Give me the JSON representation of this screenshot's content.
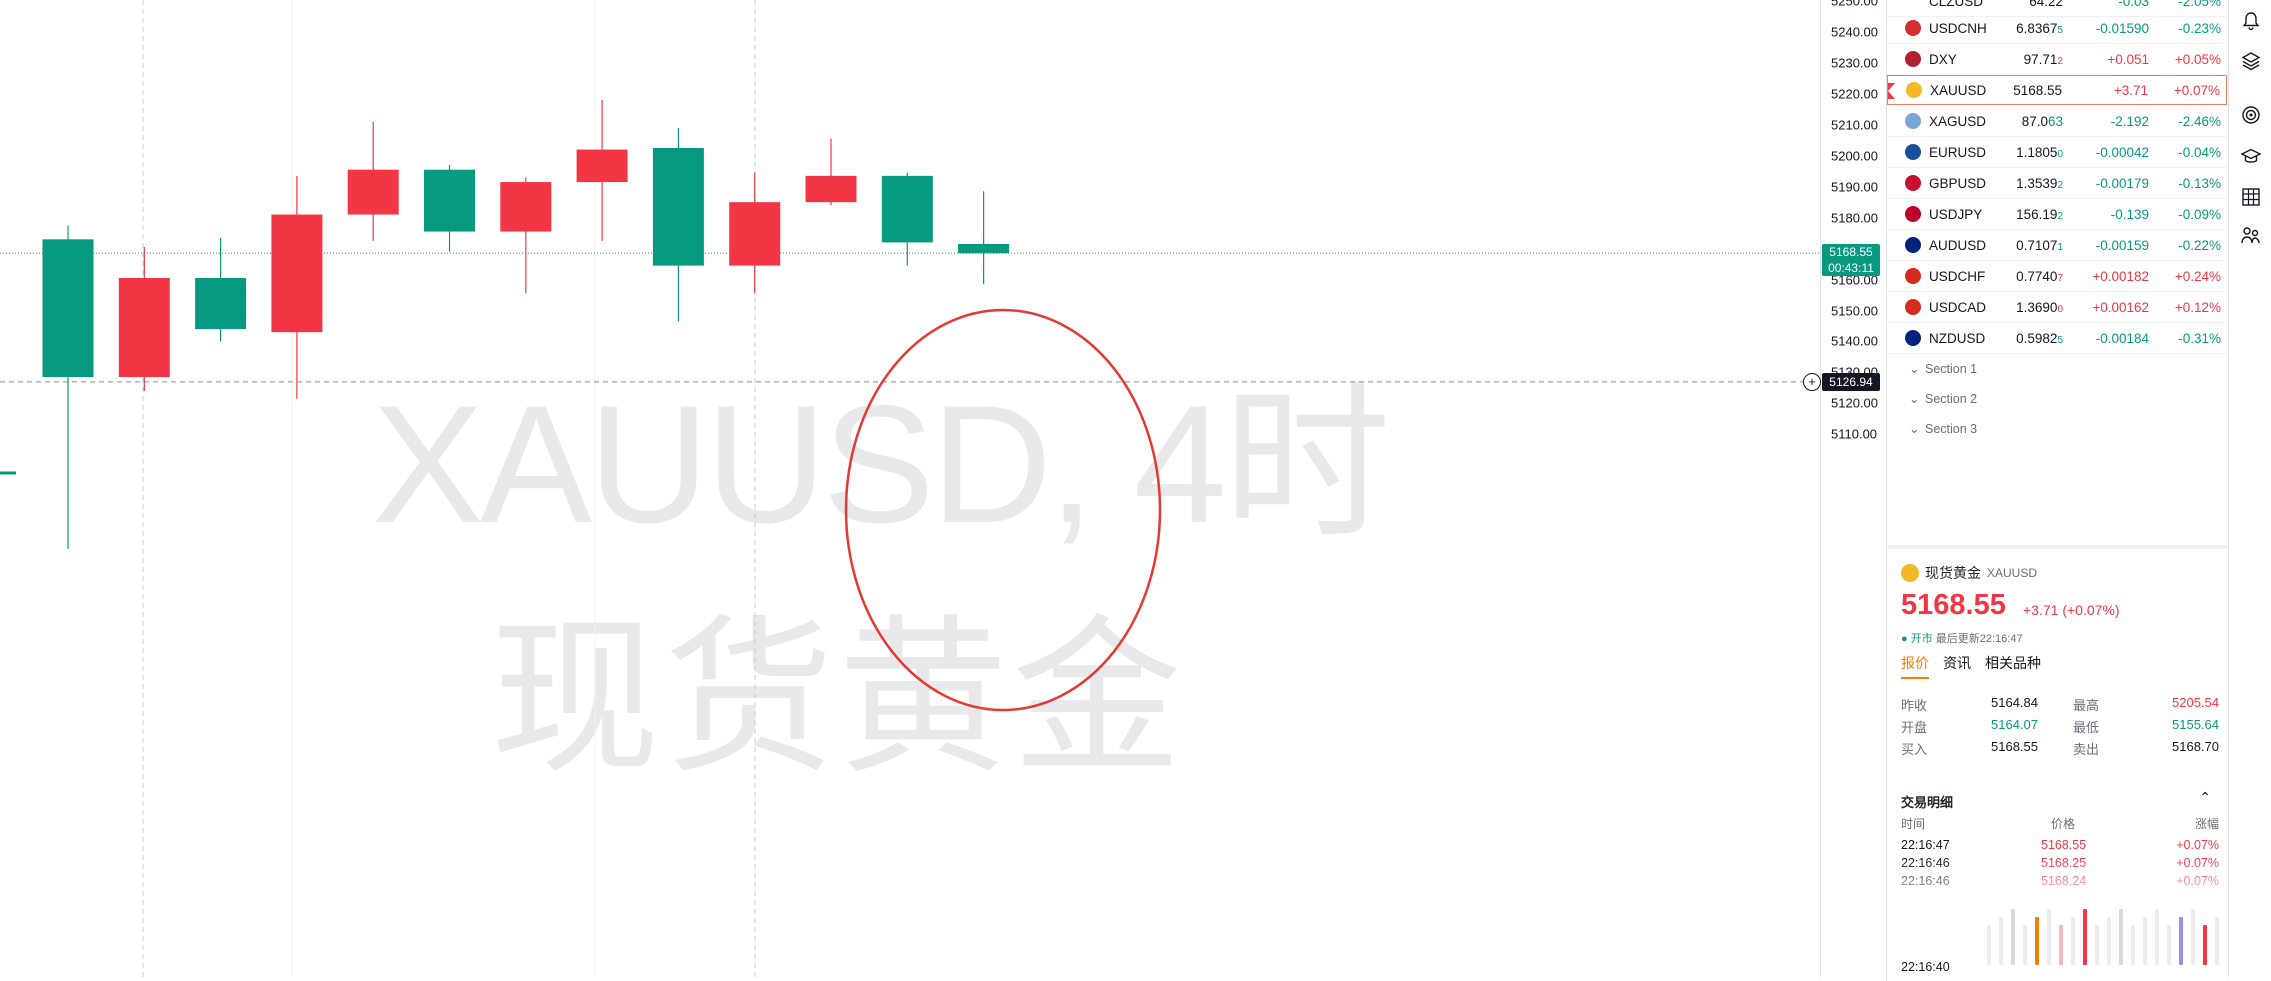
{
  "chart": {
    "watermark_symbol": "XAUUSD, 4时",
    "watermark_name": "现货黄金",
    "price_ticks": [
      "5250.00",
      "5240.00",
      "5230.00",
      "5220.00",
      "5210.00",
      "5200.00",
      "5190.00",
      "5180.00",
      "5170.00",
      "5160.00",
      "5150.00",
      "5140.00",
      "5130.00",
      "5120.00",
      "5110.00"
    ],
    "last_price_label": "5168.55",
    "last_price_timer": "00:43:11",
    "crosshair_price_label": "5126.94",
    "colors": {
      "up": "#f23645",
      "down": "#089981",
      "annotation": "#e53935"
    }
  },
  "chart_data": {
    "type": "candlestick",
    "symbol": "XAUUSD",
    "interval": "4时",
    "ylim": [
      5099,
      5252
    ],
    "price_axis": "right",
    "last_price": 5168.55,
    "crosshair_price": 5126.94,
    "candles": [
      {
        "open": 5128.5,
        "high": 5177.5,
        "low": 5073.0,
        "close": 5173.0,
        "color": "down"
      },
      {
        "open": 5128.5,
        "high": 5170.5,
        "low": 5124.0,
        "close": 5160.5,
        "color": "up"
      },
      {
        "open": 5144.0,
        "high": 5173.5,
        "low": 5140.0,
        "close": 5160.5,
        "color": "down"
      },
      {
        "open": 5143.0,
        "high": 5193.5,
        "low": 5121.5,
        "close": 5181.0,
        "color": "up"
      },
      {
        "open": 5181.0,
        "high": 5211.0,
        "low": 5172.5,
        "close": 5195.5,
        "color": "up"
      },
      {
        "open": 5175.5,
        "high": 5197.0,
        "low": 5169.0,
        "close": 5195.5,
        "color": "down"
      },
      {
        "open": 5175.5,
        "high": 5193.0,
        "low": 5155.5,
        "close": 5191.5,
        "color": "up"
      },
      {
        "open": 5191.5,
        "high": 5218.0,
        "low": 5172.5,
        "close": 5202.0,
        "color": "up"
      },
      {
        "open": 5164.5,
        "high": 5209.0,
        "low": 5146.5,
        "close": 5202.5,
        "color": "down"
      },
      {
        "open": 5164.5,
        "high": 5194.5,
        "low": 5155.5,
        "close": 5185.0,
        "color": "up"
      },
      {
        "open": 5185.0,
        "high": 5205.5,
        "low": 5184.0,
        "close": 5193.5,
        "color": "up"
      },
      {
        "open": 5172.0,
        "high": 5194.5,
        "low": 5164.5,
        "close": 5193.5,
        "color": "down"
      },
      {
        "open": 5171.5,
        "high": 5188.5,
        "low": 5158.5,
        "close": 5168.5,
        "color": "down"
      }
    ]
  },
  "watchlist": {
    "partial_top": {
      "symbol": "CLZUSD",
      "last": "64.22",
      "chg": "-0.03",
      "pct": "-2.05%"
    },
    "rows": [
      {
        "symbol": "USDCNH",
        "last": "6.8367",
        "sub": "5",
        "chg": "-0.01590",
        "pct": "-0.23%",
        "dir": "down",
        "icon": "us-cn-flag-icon",
        "iconColor": "#d32f2f"
      },
      {
        "symbol": "DXY",
        "last": "97.71",
        "sub": "2",
        "chg": "+0.051",
        "pct": "+0.05%",
        "dir": "up",
        "icon": "us-flag-icon",
        "iconColor": "#b22234"
      },
      {
        "symbol": "XAUUSD",
        "last": "5168.55",
        "sub": "",
        "chg": "+3.71",
        "pct": "+0.07%",
        "dir": "up",
        "icon": "gold-coin-icon",
        "iconColor": "#f5b827",
        "active": true
      },
      {
        "symbol": "XAGUSD",
        "last": "87.0",
        "sub": "63",
        "chg": "-2.192",
        "pct": "-2.46%",
        "dir": "down",
        "icon": "silver-coin-icon",
        "iconColor": "#7aa7d8"
      },
      {
        "symbol": "EURUSD",
        "last": "1.1805",
        "sub": "0",
        "chg": "-0.00042",
        "pct": "-0.04%",
        "dir": "down",
        "icon": "eu-us-flag-icon",
        "iconColor": "#1a4fa0"
      },
      {
        "symbol": "GBPUSD",
        "last": "1.3539",
        "sub": "2",
        "chg": "-0.00179",
        "pct": "-0.13%",
        "dir": "down",
        "icon": "gb-us-flag-icon",
        "iconColor": "#c8102e"
      },
      {
        "symbol": "USDJPY",
        "last": "156.19",
        "sub": "2",
        "chg": "-0.139",
        "pct": "-0.09%",
        "dir": "down",
        "icon": "us-jp-flag-icon",
        "iconColor": "#bc002d"
      },
      {
        "symbol": "AUDUSD",
        "last": "0.7107",
        "sub": "1",
        "chg": "-0.00159",
        "pct": "-0.22%",
        "dir": "down",
        "icon": "au-us-flag-icon",
        "iconColor": "#00247d"
      },
      {
        "symbol": "USDCHF",
        "last": "0.7740",
        "sub": "7",
        "chg": "+0.00182",
        "pct": "+0.24%",
        "dir": "up",
        "icon": "us-ch-flag-icon",
        "iconColor": "#d52b1e"
      },
      {
        "symbol": "USDCAD",
        "last": "1.3690",
        "sub": "0",
        "chg": "+0.00162",
        "pct": "+0.12%",
        "dir": "up",
        "icon": "us-ca-flag-icon",
        "iconColor": "#d52b1e"
      },
      {
        "symbol": "NZDUSD",
        "last": "0.5982",
        "sub": "5",
        "chg": "-0.00184",
        "pct": "-0.31%",
        "dir": "down",
        "icon": "nz-us-flag-icon",
        "iconColor": "#00247d"
      }
    ],
    "sections": [
      "Section 1",
      "Section 2",
      "Section 3"
    ]
  },
  "details": {
    "name": "现货黄金",
    "code": "XAUUSD",
    "price": "5168.55",
    "change": "+3.71 (+0.07%)",
    "status_open": "● 开市",
    "status_updated": "最后更新22:16:47",
    "tabs": [
      "报价",
      "资讯",
      "相关品种"
    ],
    "quote": [
      {
        "l1": "昨收",
        "v1": "5164.84",
        "l2": "最高",
        "v2": "5205.54",
        "c1": "#131722",
        "c2": "#f23645"
      },
      {
        "l1": "开盘",
        "v1": "5164.07",
        "l2": "最低",
        "v2": "5155.64",
        "c1": "#089981",
        "c2": "#089981"
      },
      {
        "l1": "买入",
        "v1": "5168.55",
        "l2": "卖出",
        "v2": "5168.70",
        "c1": "#131722",
        "c2": "#131722"
      }
    ],
    "trades_title": "交易明细",
    "trades_head": {
      "time": "时间",
      "price": "价格",
      "chg": "涨幅"
    },
    "trades": [
      {
        "time": "22:16:47",
        "price": "5168.55",
        "chg": "+0.07%"
      },
      {
        "time": "22:16:46",
        "price": "5168.25",
        "chg": "+0.07%"
      },
      {
        "time": "22:16:46",
        "price": "5168.24",
        "chg": "+0.07%"
      }
    ],
    "bottom_time": "22:16:40"
  }
}
